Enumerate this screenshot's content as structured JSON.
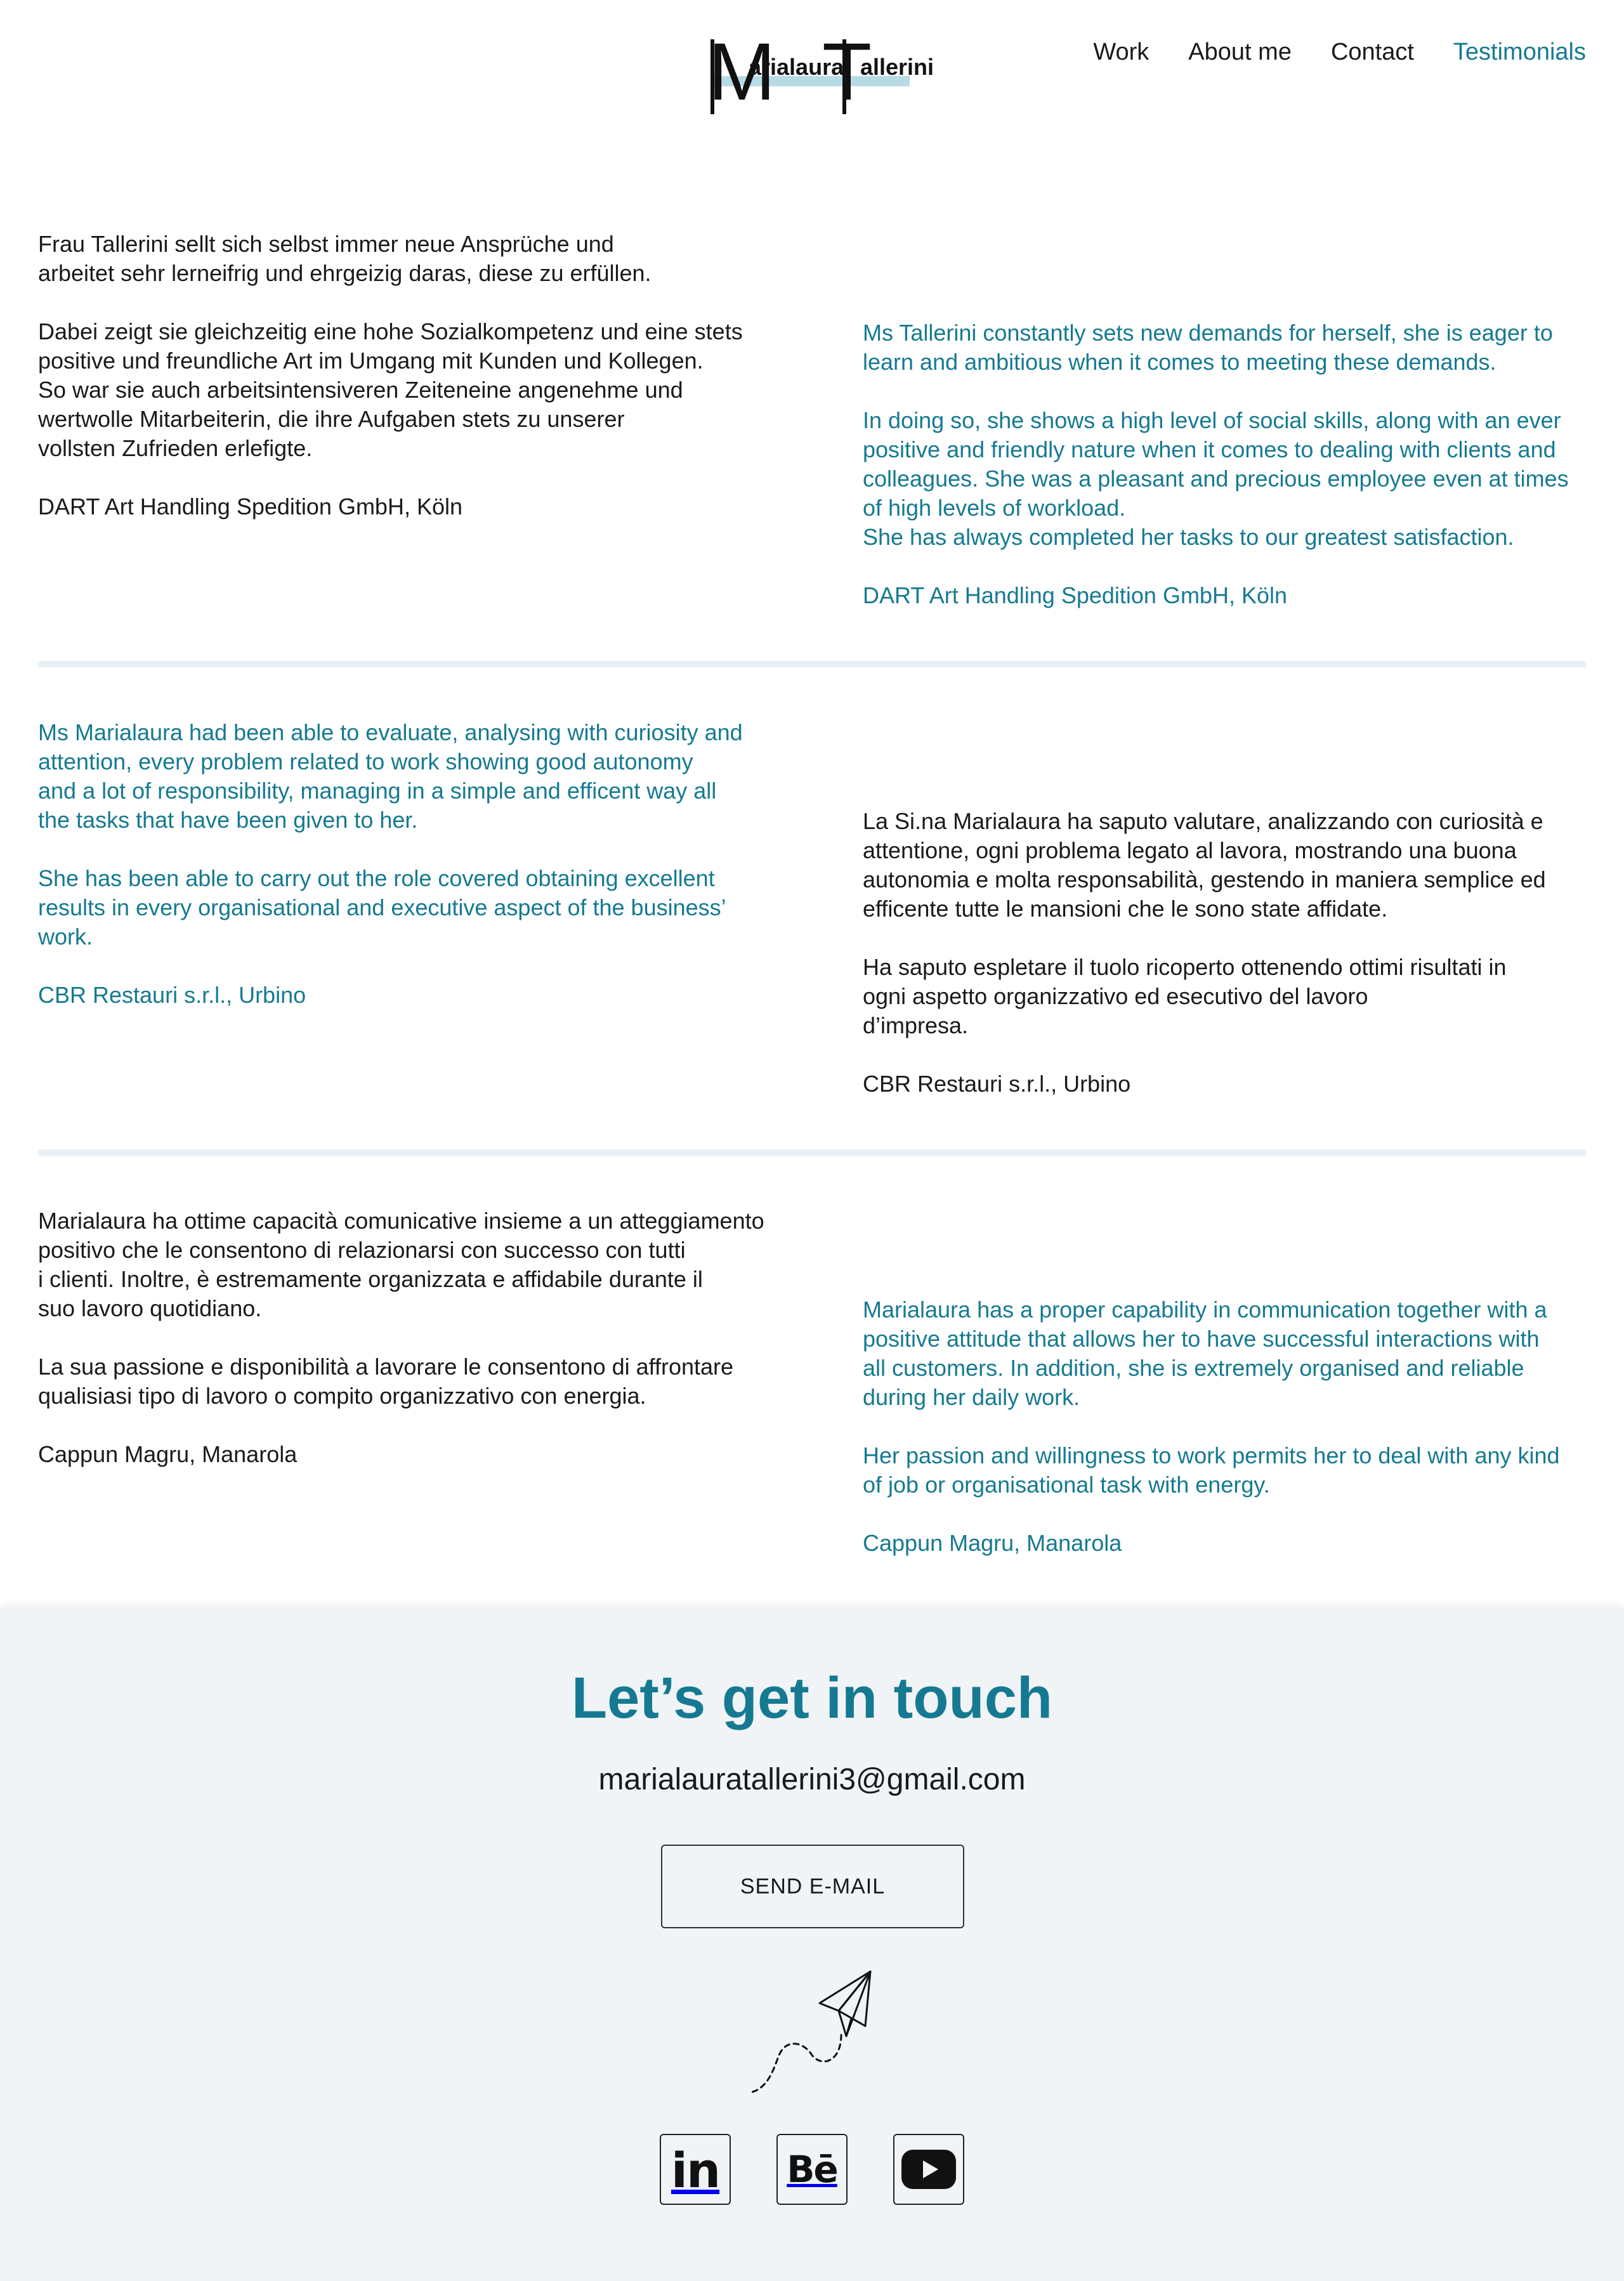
{
  "logo": {
    "big_m": "M",
    "first": "arialaura",
    "big_t": "T",
    "last": "allerini"
  },
  "nav": {
    "items": [
      "Work",
      "About me",
      "Contact",
      "Testimonials"
    ],
    "active": "Testimonials"
  },
  "testimonials": [
    {
      "left": {
        "color": "black",
        "text": "Frau Tallerini sellt sich selbst immer neue Ansprüche und\narbeitet sehr lerneifrig und ehrgeizig daras, diese zu erfüllen.\n\nDabei zeigt sie gleichzeitig eine hohe Sozialkompetenz und eine stets\npositive und freundliche Art im Umgang mit Kunden und Kollegen.\nSo war sie auch arbeitsintensiveren Zeiteneine angenehme und\nwertwolle Mitarbeiterin, die ihre Aufgaben stets zu unserer\nvollsten Zufrieden erlefigte.\n\nDART Art Handling Spedition GmbH, Köln"
      },
      "right": {
        "color": "teal",
        "text": "Ms Tallerini constantly sets new demands for herself, she is eager to\nlearn and ambitious when it comes to meeting these demands.\n\nIn doing so, she shows a high level of social skills, along with an ever\npositive and friendly nature when it comes to dealing with clients and\ncolleagues. She was a pleasant and precious employee even at times\nof high levels of workload.\nShe has always completed her tasks to our greatest satisfaction.\n\nDART Art Handling Spedition GmbH, Köln"
      }
    },
    {
      "left": {
        "color": "teal",
        "text": "Ms Marialaura had been able to evaluate, analysing with curiosity and\nattention, every problem related to work showing good autonomy\nand a lot of responsibility, managing in a simple and efficent way all\nthe tasks that have been given to her.\n\nShe has been able to carry out the role covered obtaining excellent\nresults in every organisational and executive aspect of the business’\nwork.\n\nCBR Restauri s.r.l., Urbino"
      },
      "right": {
        "color": "black",
        "text": "La Si.na Marialaura ha saputo valutare, analizzando con curiosità e\nattentione, ogni problema legato al lavora, mostrando una buona\nautonomia e molta responsabilità, gestendo in maniera semplice ed\nefficente tutte le mansioni che le sono state affidate.\n\nHa saputo espletare il tuolo ricoperto ottenendo ottimi risultati in\nogni aspetto organizzativo ed esecutivo del lavoro\nd’impresa.\n\nCBR Restauri s.r.l., Urbino"
      }
    },
    {
      "left": {
        "color": "black",
        "text": "Marialaura ha ottime capacità comunicative insieme a un atteggiamento\npositivo che le consentono di relazionarsi con successo con tutti\ni clienti. Inoltre, è estremamente organizzata e affidabile durante il\nsuo lavoro quotidiano.\n\nLa sua passione e disponibilità a lavorare le consentono di affrontare\nqualisiasi tipo di lavoro o compito organizzativo con energia.\n\nCappun Magru, Manarola"
      },
      "right": {
        "color": "teal",
        "text": "Marialaura has a proper capability in communication together with a\npositive attitude that allows her to have successful interactions with\nall customers. In addition, she is extremely organised and reliable\nduring her daily work.\n\nHer passion and willingness to work permits her to deal with any kind\nof job or organisational task with energy.\n\nCappun Magru, Manarola"
      }
    }
  ],
  "contact": {
    "title": "Let’s get in touch",
    "email": "marialauratallerini3@gmail.com",
    "button_label": "SEND E-MAIL",
    "linkedin_label": "in",
    "behance_label": "Bē"
  },
  "icons": {
    "plane": "paper-plane-icon",
    "linkedin": "linkedin-icon",
    "behance": "behance-icon",
    "youtube": "youtube-icon"
  },
  "colors": {
    "accent": "#157a91",
    "logo_bar": "#b7dbe5",
    "divider": "#e8f0f5",
    "footer_bg": "#f0f4f7",
    "text": "#1a1a1a"
  }
}
